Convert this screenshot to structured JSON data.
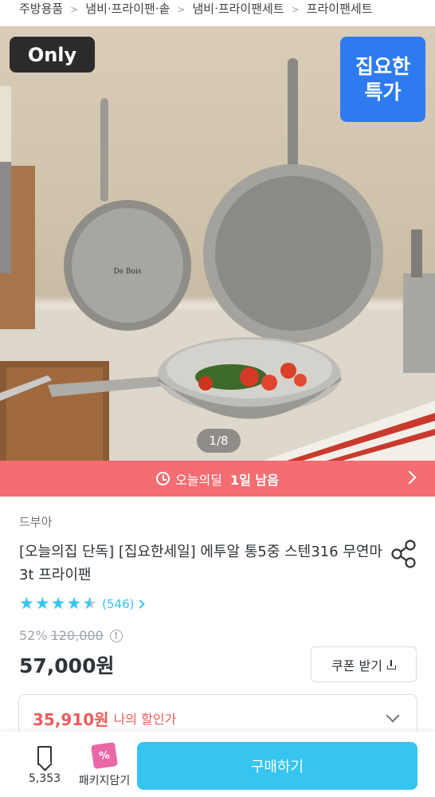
{
  "breadcrumb": [
    "주방용품",
    "냄비·프라이팬·솥",
    "냄비·프라이팬세트",
    "프라이팬세트"
  ],
  "hero": {
    "only_badge": "Only",
    "sale_badge_line1": "집요한",
    "sale_badge_line2": "특가",
    "page_indicator": "1/8",
    "pan_brand": "De Bois"
  },
  "deal_banner": {
    "label": "오늘의딜",
    "remaining": "1일 남음"
  },
  "product": {
    "brand": "드부아",
    "title": "[오늘의집 단독] [집요한세일] 에투알 통5중 스텐316 무연마 3t 프라이팬",
    "rating": 4.5,
    "review_count": "(546)",
    "discount_rate": "52%",
    "original_price": "120,000",
    "sale_price": "57,000원",
    "info_icon": "!",
    "coupon_label": "쿠폰 받기",
    "my_discount_amount": "35,910원",
    "my_discount_label": "나의 할인가"
  },
  "bottom_bar": {
    "bookmark_count": "5,353",
    "package_label": "패키지담기",
    "package_icon_text": "%",
    "buy_label": "구매하기"
  },
  "colors": {
    "accent": "#35c5f0",
    "deal": "#f36d73",
    "discount": "#f05a5a",
    "sale_badge": "#2e7bf0"
  }
}
